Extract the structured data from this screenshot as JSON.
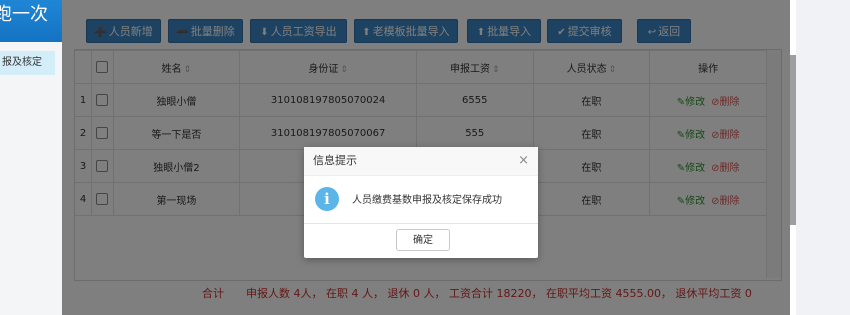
{
  "sidebar": {
    "title": "跑一次",
    "active_item": "报及核定"
  },
  "toolbar": {
    "buttons": [
      {
        "label": "人员新增",
        "icon": "user-plus-icon"
      },
      {
        "label": "批量删除",
        "icon": "user-minus-icon"
      },
      {
        "label": "人员工资导出",
        "icon": "download-icon"
      },
      {
        "label": "老模板批量导入",
        "icon": "upload-icon"
      },
      {
        "label": "批量导入",
        "icon": "upload-icon"
      },
      {
        "label": "提交审核",
        "icon": "check-icon"
      },
      {
        "label": "返回",
        "icon": "back-icon"
      }
    ]
  },
  "table": {
    "columns": [
      "姓名",
      "身份证",
      "申报工资",
      "人员状态",
      "操作"
    ],
    "rows": [
      {
        "num": "1",
        "name": "独眼小僧",
        "id": "310108197805070024",
        "salary": "6555",
        "status": "在职"
      },
      {
        "num": "2",
        "name": "等一下是否",
        "id": "310108197805070067",
        "salary": "555",
        "status": "在职"
      },
      {
        "num": "3",
        "name": "独眼小僧2",
        "id": "310108",
        "salary": "",
        "status": "在职"
      },
      {
        "num": "4",
        "name": "第一现场",
        "id": "310108",
        "salary": "",
        "status": "在职"
      }
    ],
    "edit_label": "修改",
    "delete_label": "删除"
  },
  "footer": {
    "label": "合计",
    "summary": "申报人数 4人， 在职 4 人， 退休 0 人， 工资合计 18220， 在职平均工资 4555.00， 退休平均工资 0"
  },
  "dialog": {
    "title": "信息提示",
    "close": "×",
    "message": "人员缴费基数申报及核定保存成功",
    "ok_label": "确定"
  },
  "colors": {
    "button": "#3d87c5",
    "info_icon": "#5bb5e8",
    "footer_text": "#c9302c",
    "edit": "#2f8f2f",
    "delete": "#d9534f"
  }
}
